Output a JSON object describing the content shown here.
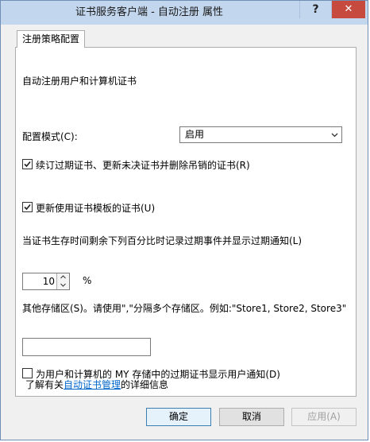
{
  "window": {
    "title": "证书服务客户端 - 自动注册 属性",
    "help_label": "?",
    "close_label": "✕"
  },
  "tabs": [
    {
      "label": "注册策略配置"
    }
  ],
  "panel": {
    "heading": "自动注册用户和计算机证书",
    "config_mode_label": "配置模式(C):",
    "config_mode_value": "启用",
    "renew_checkbox_label": "续订过期证书、更新未决证书并删除吊销的证书(R)",
    "renew_checked": true,
    "update_template_label": "更新使用证书模板的证书(U)",
    "update_template_checked": true,
    "expiry_event_label": "当证书生存时间剩余下列百分比时记录过期事件并显示过期通知(L)",
    "percent_value": "10",
    "percent_unit": "%",
    "other_stores_label": "其他存储区(S)。请使用\",\"分隔多个存储区。例如:\"Store1, Store2, Store3\"",
    "other_stores_value": "",
    "notify_label": "为用户和计算机的 MY 存储中的过期证书显示用户通知(D)",
    "notify_checked": false,
    "learn_more_prefix": "了解有关",
    "learn_more_link": "自动证书管理",
    "learn_more_suffix": "的详细信息"
  },
  "buttons": {
    "ok": "确定",
    "cancel": "取消",
    "apply": "应用(A)"
  }
}
